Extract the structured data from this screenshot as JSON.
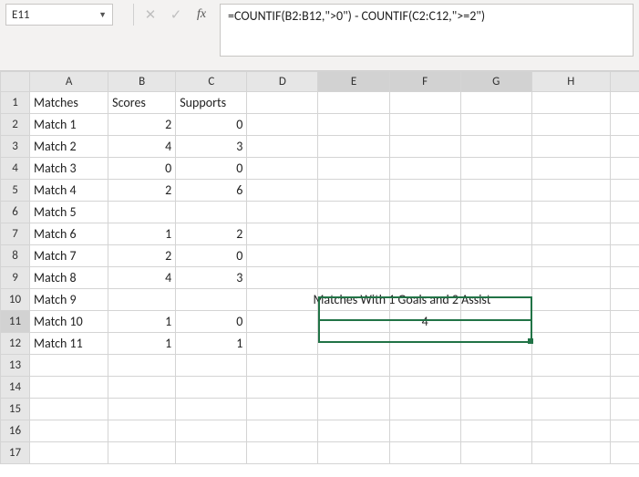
{
  "nameBox": {
    "value": "E11"
  },
  "formulaBar": {
    "formula": "=COUNTIF(B2:B12,\">0\") - COUNTIF(C2:C12,\">=2\")"
  },
  "columns": [
    "A",
    "B",
    "C",
    "D",
    "E",
    "F",
    "G",
    "H",
    ""
  ],
  "headers": {
    "A": "Matches",
    "B": "Scores",
    "C": "Supports"
  },
  "rows": [
    {
      "n": 1,
      "A": "Matches",
      "B": "Scores",
      "C": "Supports"
    },
    {
      "n": 2,
      "A": "Match 1",
      "B": 2,
      "C": 0
    },
    {
      "n": 3,
      "A": "Match 2",
      "B": 4,
      "C": 3
    },
    {
      "n": 4,
      "A": "Match 3",
      "B": 0,
      "C": 0
    },
    {
      "n": 5,
      "A": "Match 4",
      "B": 2,
      "C": 6
    },
    {
      "n": 6,
      "A": "Match 5"
    },
    {
      "n": 7,
      "A": "Match 6",
      "B": 1,
      "C": 2
    },
    {
      "n": 8,
      "A": "Match 7",
      "B": 2,
      "C": 0
    },
    {
      "n": 9,
      "A": "Match 8",
      "B": 4,
      "C": 3
    },
    {
      "n": 10,
      "A": "Match 9",
      "E_overflow": "Matches With 1 Goals and 2 Assist"
    },
    {
      "n": 11,
      "A": "Match 10",
      "B": 1,
      "C": 0,
      "F": 4
    },
    {
      "n": 12,
      "A": "Match 11",
      "B": 1,
      "C": 1
    },
    {
      "n": 13
    },
    {
      "n": 14
    },
    {
      "n": 15
    },
    {
      "n": 16
    },
    {
      "n": 17
    }
  ],
  "selection": {
    "cell": "E11",
    "mergedRange": "E11:G11",
    "topLabelRange": "E10:G10"
  },
  "colors": {
    "selection": "#217346",
    "grid": "#d4d4d4",
    "header": "#e6e6e6"
  }
}
